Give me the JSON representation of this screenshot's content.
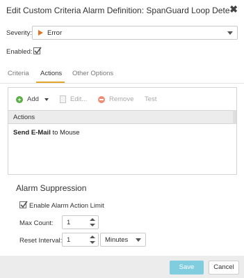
{
  "dialog": {
    "title": "Edit Custom Criteria Alarm Definition: SpanGuard Loop Detect…",
    "close_icon": "close-icon"
  },
  "severity": {
    "label": "Severity:",
    "value": "Error",
    "icon": "severity-flag-icon",
    "icon_color": "#e2742a"
  },
  "enabled": {
    "label": "Enabled:",
    "checked": true
  },
  "tabs": [
    {
      "label": "Criteria",
      "active": false
    },
    {
      "label": "Actions",
      "active": true
    },
    {
      "label": "Other Options",
      "active": false
    }
  ],
  "toolbar": {
    "add_label": "Add",
    "edit_label": "Edit...",
    "remove_label": "Remove",
    "test_label": "Test"
  },
  "grid": {
    "header": "Actions",
    "rows": [
      {
        "action": "Send E-Mail",
        "suffix": " to Mouse"
      }
    ]
  },
  "suppression": {
    "title": "Alarm Suppression",
    "enable_label": "Enable Alarm Action Limit",
    "enable_checked": true,
    "max_count_label": "Max Count:",
    "max_count_value": "1",
    "reset_interval_label": "Reset Interval:",
    "reset_interval_value": "1",
    "reset_interval_unit": "Minutes"
  },
  "footer": {
    "save_label": "Save",
    "cancel_label": "Cancel"
  },
  "colors": {
    "accent_tab": "#e4a52b",
    "save_button": "#80cde0",
    "add_icon": "#5aac44",
    "remove_icon": "#f08b73"
  }
}
